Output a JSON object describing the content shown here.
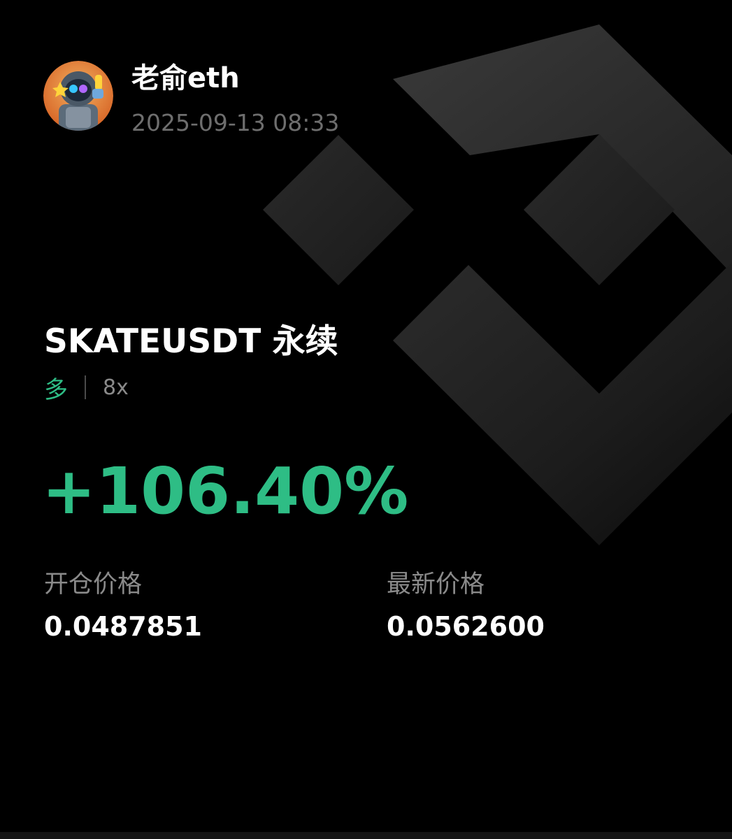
{
  "header": {
    "username": "老俞eth",
    "timestamp": "2025-09-13 08:33"
  },
  "position": {
    "symbol_title": "SKATEUSDT 永续",
    "side": "多",
    "leverage": "8x",
    "roi": "+106.40%"
  },
  "prices": {
    "entry_label": "开仓价格",
    "entry_value": "0.0487851",
    "mark_label": "最新价格",
    "mark_value": "0.0562600"
  },
  "colors": {
    "background": "#000000",
    "profit_green": "#2ebd85",
    "muted_text": "#8a8a8a",
    "primary_text": "#ffffff"
  },
  "icons": {
    "background_logo": "exchange-logo-icon",
    "avatar": "robot-avatar"
  }
}
